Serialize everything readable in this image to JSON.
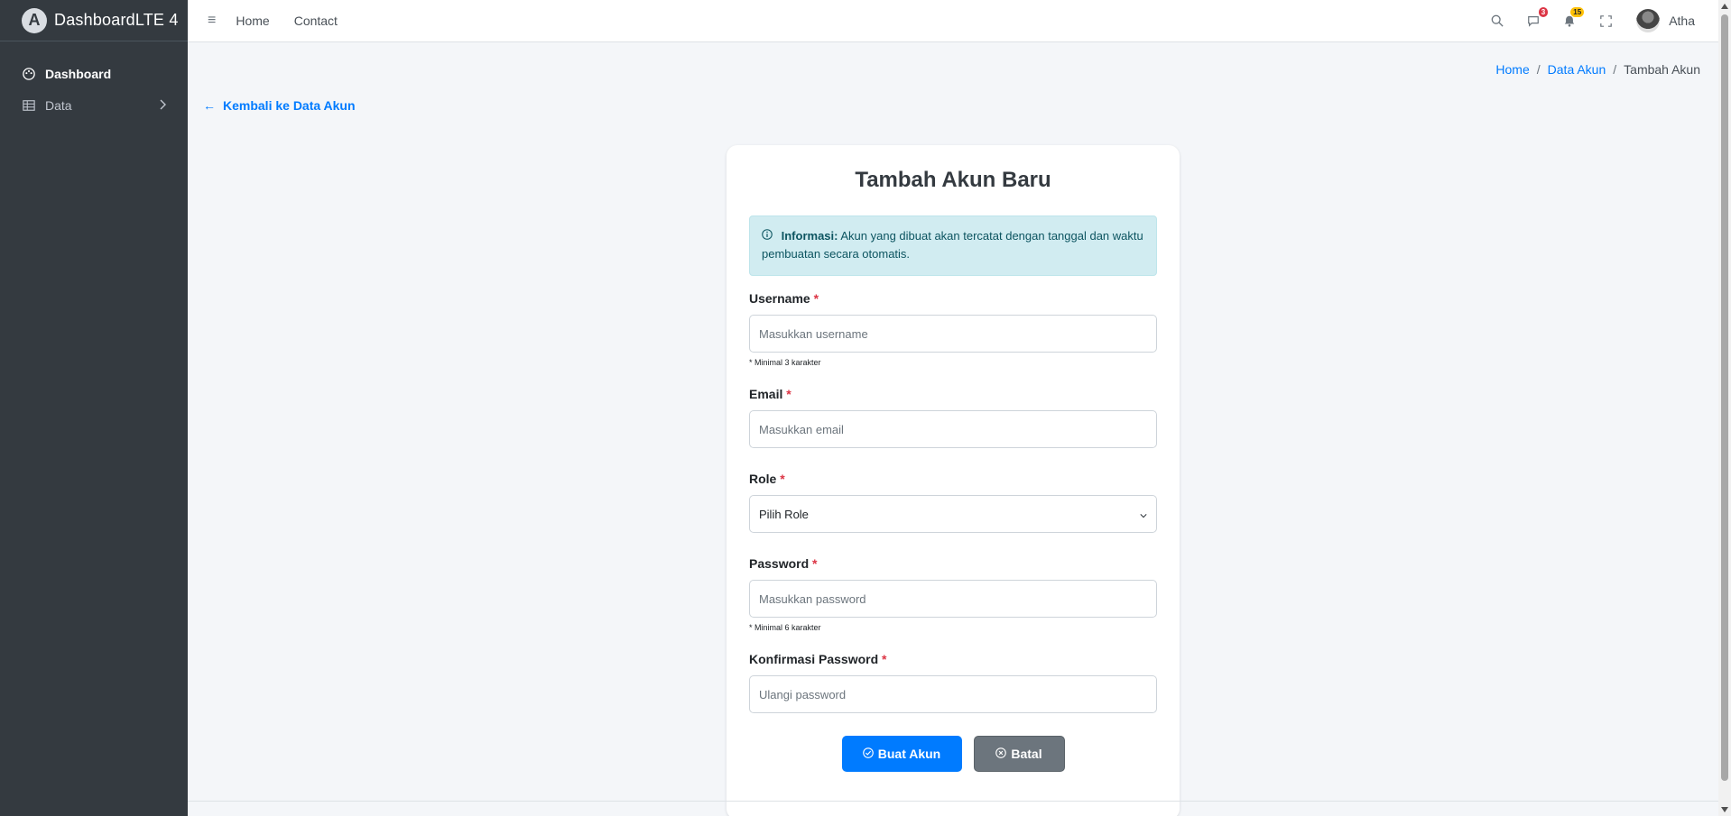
{
  "brand": {
    "name": "DashboardLTE 4",
    "logo_letter": "A"
  },
  "sidebar": {
    "items": [
      {
        "label": "Dashboard",
        "icon": "palette-icon"
      },
      {
        "label": "Data",
        "icon": "table-icon"
      }
    ]
  },
  "topbar": {
    "links": [
      "Home",
      "Contact"
    ],
    "messages_count": "3",
    "notifications_count": "15",
    "user_name": "Atha"
  },
  "breadcrumb": {
    "home": "Home",
    "section": "Data Akun",
    "current": "Tambah Akun",
    "separator": "/"
  },
  "back_link": "Kembali ke Data Akun",
  "form": {
    "title": "Tambah Akun Baru",
    "info_title": "Informasi:",
    "info_text": "Akun yang dibuat akan tercatat dengan tanggal dan waktu pembuatan secara otomatis.",
    "username": {
      "label": "Username",
      "placeholder": "Masukkan username",
      "hint": "* Minimal 3 karakter"
    },
    "email": {
      "label": "Email",
      "placeholder": "Masukkan email"
    },
    "role": {
      "label": "Role",
      "selected": "Pilih Role"
    },
    "password": {
      "label": "Password",
      "placeholder": "Masukkan password",
      "hint": "* Minimal 6 karakter"
    },
    "confirm_password": {
      "label": "Konfirmasi Password",
      "placeholder": "Ulangi password"
    },
    "required_mark": "*",
    "submit_label": "Buat Akun",
    "cancel_label": "Batal"
  },
  "colors": {
    "primary": "#007bff",
    "secondary": "#6c757d",
    "sidebar": "#343a40",
    "danger": "#dc3545",
    "info_bg": "#d1ecf1"
  }
}
